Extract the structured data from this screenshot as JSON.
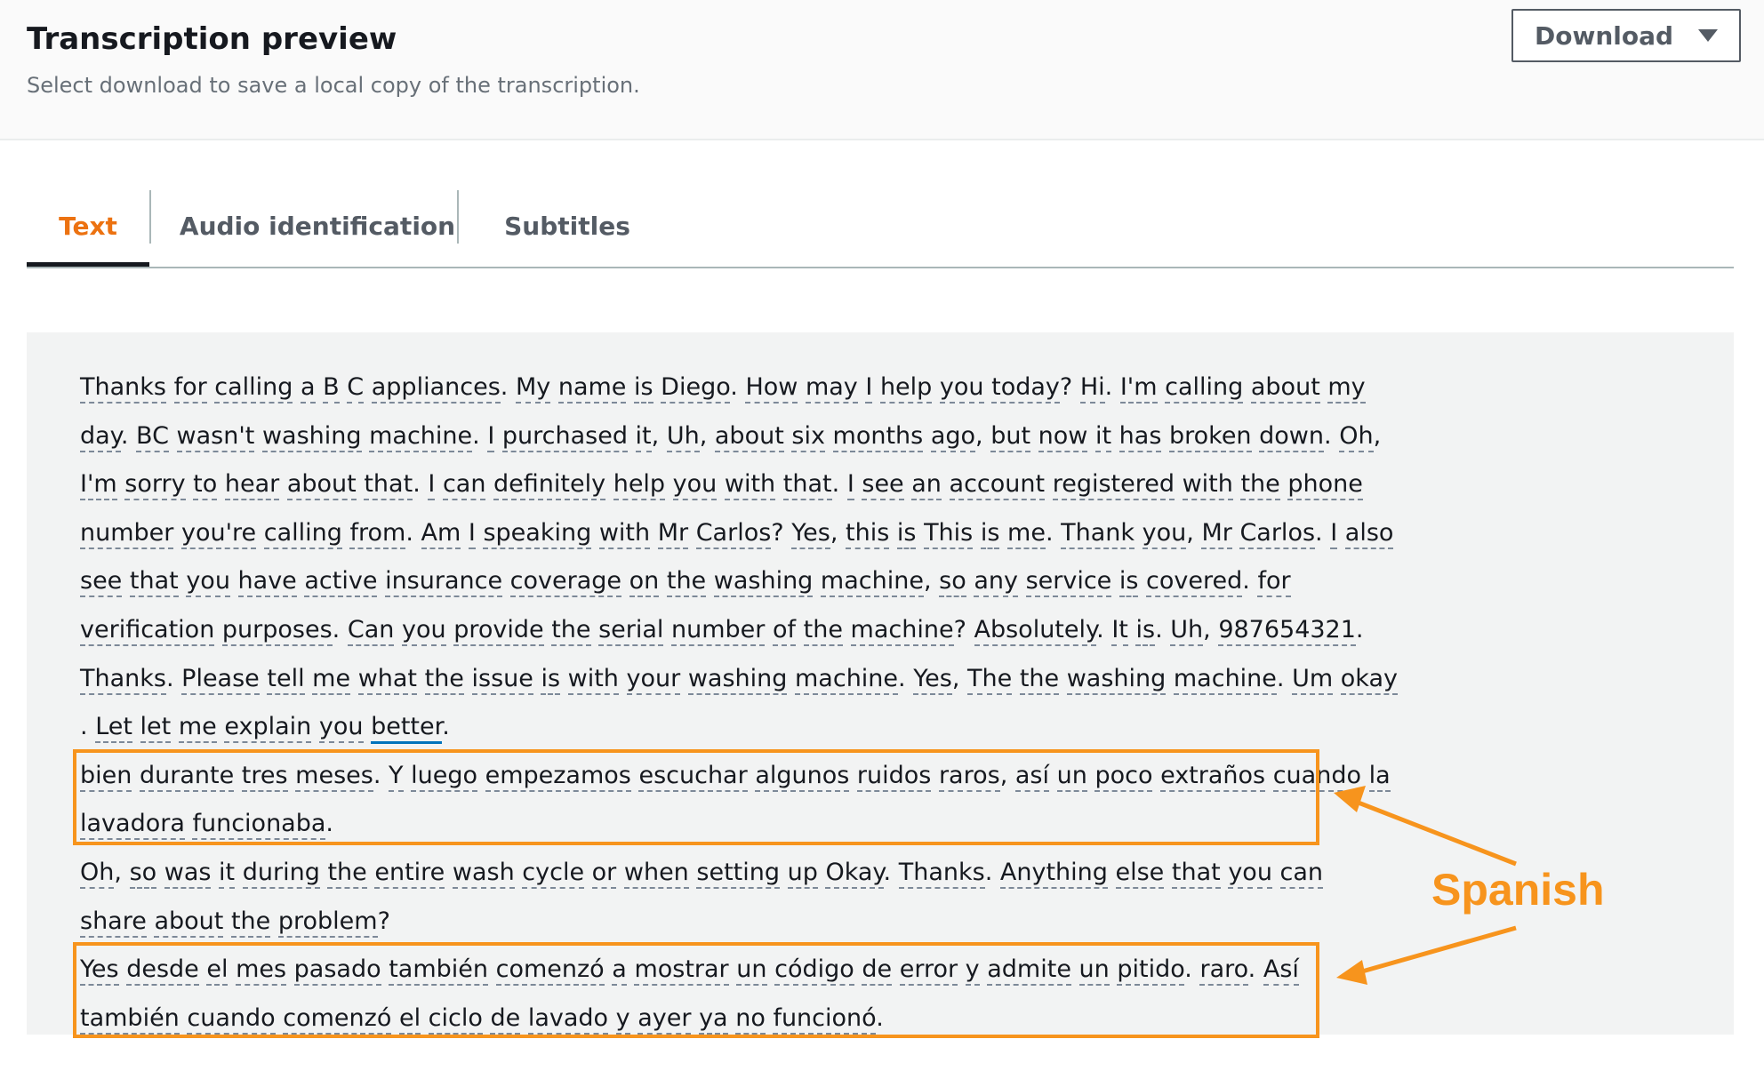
{
  "header": {
    "title": "Transcription preview",
    "subtitle": "Select download to save a local copy of the transcription.",
    "download_label": "Download"
  },
  "tabs": [
    {
      "label": "Text",
      "active": true
    },
    {
      "label": "Audio identification",
      "active": false
    },
    {
      "label": "Subtitles",
      "active": false
    }
  ],
  "transcript": {
    "lines": [
      "Thanks for calling a B C appliances. My name is Diego. How may I help you today? Hi. I'm calling about my",
      "day. BC wasn't washing machine. I purchased it, Uh, about six months ago, but now it has broken down. Oh,",
      "I'm sorry to hear about that. I can definitely help you with that. I see an account registered with the phone",
      "number you're calling from. Am I speaking with Mr Carlos? Yes, this is This is me. Thank you, Mr Carlos. I also",
      "see that you have active insurance coverage on the washing machine, so any service is covered. for",
      "verification purposes. Can you provide the serial number of the machine? Absolutely. It is. Uh, 987654321.",
      "Thanks. Please tell me what the issue is with your washing machine. Yes, The the washing machine. Um okay",
      ". Let let me explain you better.",
      "bien durante tres meses. Y luego empezamos escuchar algunos ruidos raros, así un poco extraños cuando la",
      "lavadora funcionaba.",
      "Oh, so was it during the entire wash cycle or when setting up Okay. Thanks. Anything else that you can",
      "share about the problem?",
      "Yes desde el mes pasado también comenzó a mostrar un código de error y admite un pitido. raro. Así",
      "también cuando comenzó el ciclo de lavado y ayer ya no funcionó."
    ],
    "selected_word": "better"
  },
  "annotation": {
    "label": "Spanish",
    "color": "#f7941d"
  },
  "colors": {
    "accent_tab": "#ec7211",
    "annotation": "#f7941d",
    "selected_underline": "#0073bb"
  }
}
